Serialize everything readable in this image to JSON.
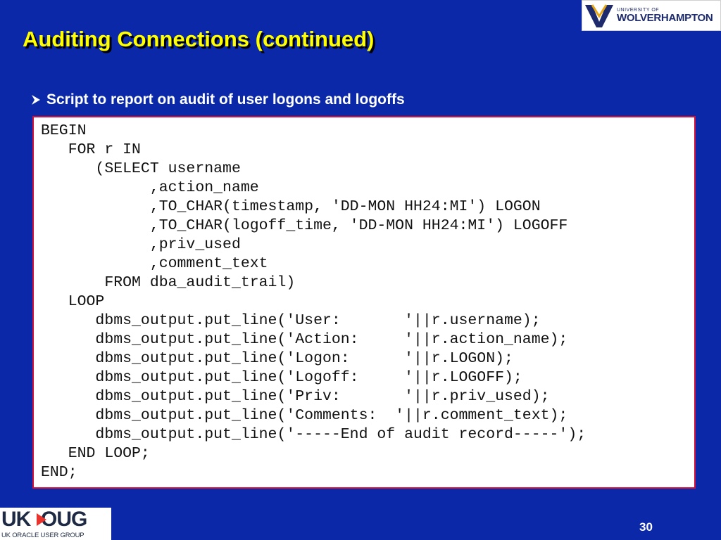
{
  "slide": {
    "title": "Auditing Connections (continued)",
    "bullet": "Script to report on audit of user logons and logoffs",
    "page_number": "30"
  },
  "logos": {
    "university_small": "UNIVERSITY OF",
    "university_name": "WOLVERHAMPTON",
    "ukoug_main": "UK  OUG",
    "ukoug_sub": "UK ORACLE USER GROUP"
  },
  "code": {
    "lines": [
      "BEGIN",
      "   FOR r IN",
      "      (SELECT username",
      "            ,action_name",
      "            ,TO_CHAR(timestamp, 'DD-MON HH24:MI') LOGON",
      "            ,TO_CHAR(logoff_time, 'DD-MON HH24:MI') LOGOFF",
      "            ,priv_used",
      "            ,comment_text",
      "       FROM dba_audit_trail)",
      "   LOOP",
      "      dbms_output.put_line('User:       '||r.username);",
      "      dbms_output.put_line('Action:     '||r.action_name);",
      "      dbms_output.put_line('Logon:      '||r.LOGON);",
      "      dbms_output.put_line('Logoff:     '||r.LOGOFF);",
      "      dbms_output.put_line('Priv:       '||r.priv_used);",
      "      dbms_output.put_line('Comments:  '||r.comment_text);",
      "      dbms_output.put_line('-----End of audit record-----');",
      "   END LOOP;",
      "END;"
    ]
  },
  "colors": {
    "background": "#0a28a8",
    "title": "#ffff00",
    "code_border": "#d0103a",
    "ukoug_accent": "#e8342c"
  },
  "icons": {
    "bullet": "arrowhead-bullet-icon",
    "university_logo": "wolverhampton-crest-icon"
  }
}
